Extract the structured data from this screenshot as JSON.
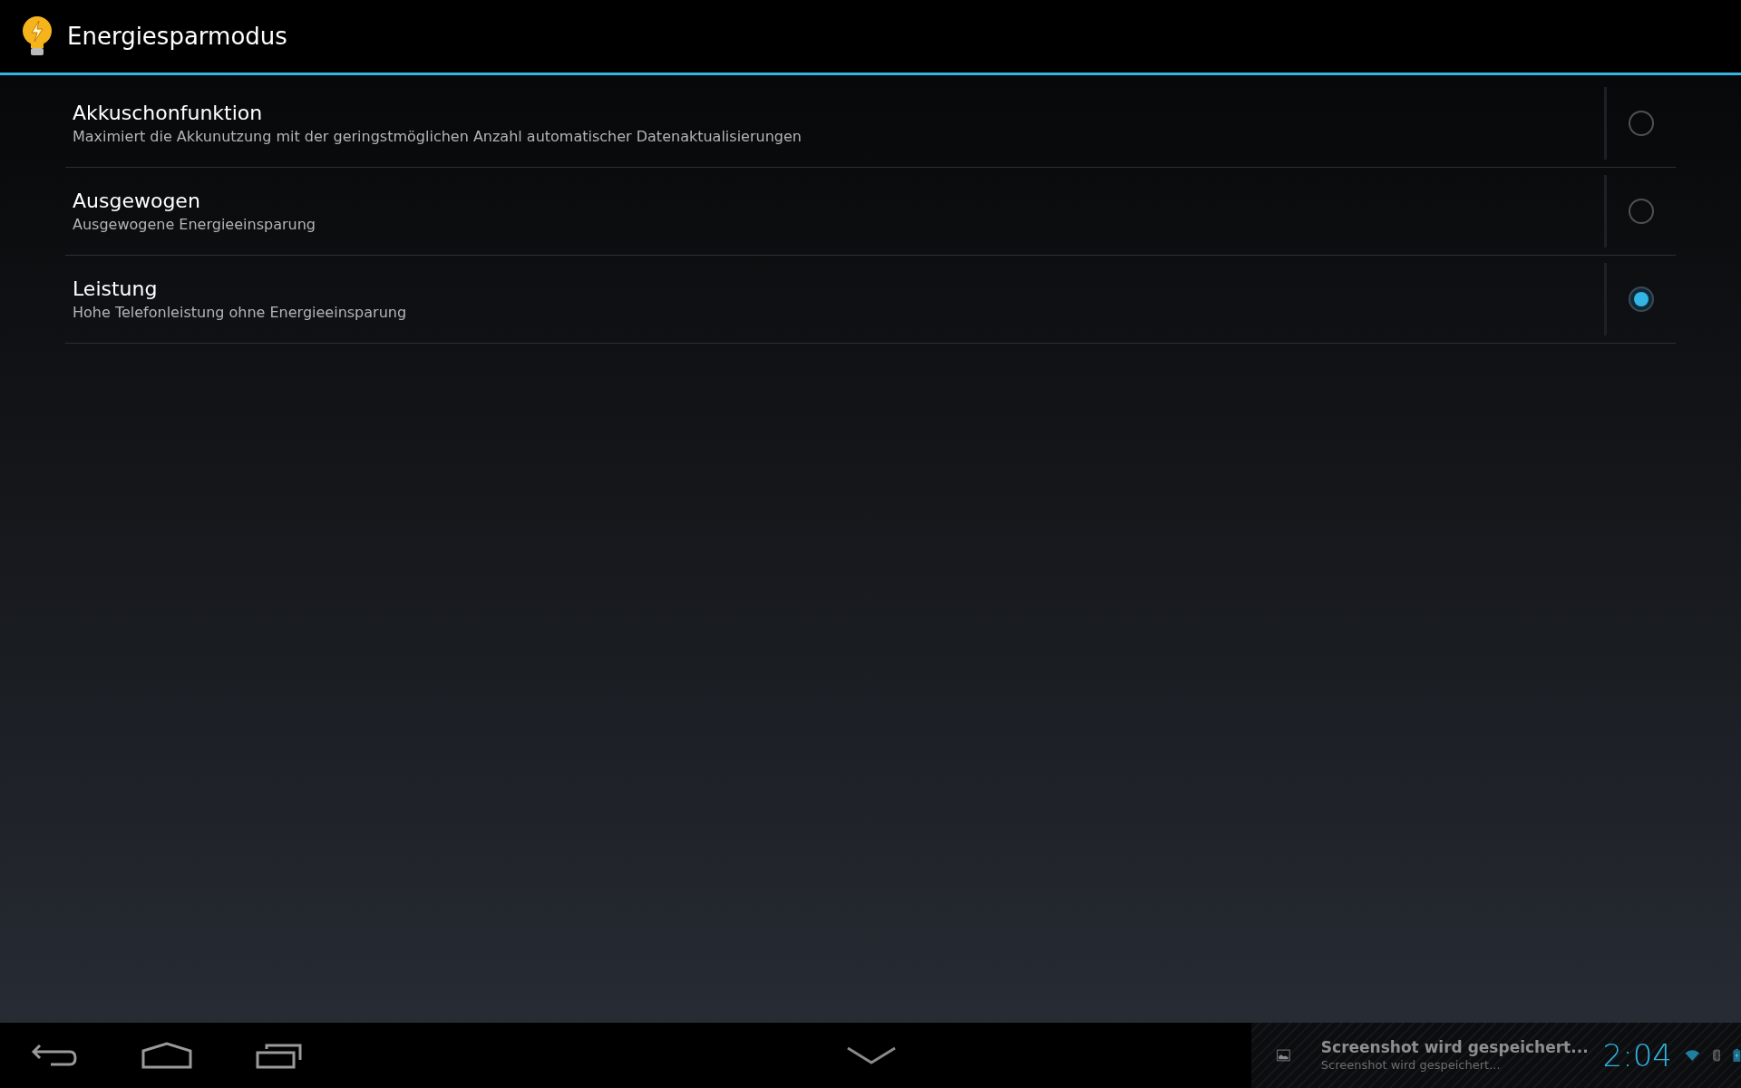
{
  "action_bar": {
    "title": "Energiesparmodus"
  },
  "options": [
    {
      "title": "Akkuschonfunktion",
      "summary": "Maximiert die Akkunutzung mit der geringstmöglichen Anzahl automatischer Datenaktualisierungen",
      "selected": false
    },
    {
      "title": "Ausgewogen",
      "summary": "Ausgewogene Energieeinsparung",
      "selected": false
    },
    {
      "title": "Leistung",
      "summary": "Hohe Telefonleistung ohne Energieeinsparung",
      "selected": true
    }
  ],
  "status_bar": {
    "notification": {
      "title": "Screenshot wird gespeichert...",
      "text": "Screenshot wird gespeichert..."
    },
    "clock": "2:04"
  }
}
